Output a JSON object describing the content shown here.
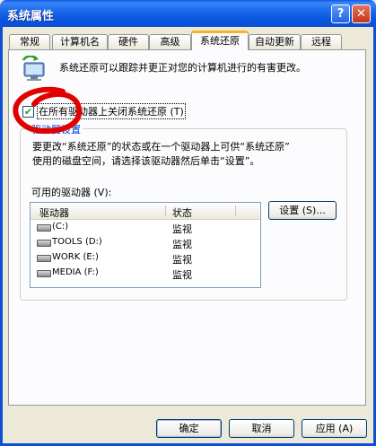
{
  "window": {
    "title": "系统属性",
    "help_glyph": "?",
    "close_glyph": "✕"
  },
  "tabs": [
    {
      "label": "常规"
    },
    {
      "label": "计算机名"
    },
    {
      "label": "硬件"
    },
    {
      "label": "高级"
    },
    {
      "label": "系统还原",
      "active": true
    },
    {
      "label": "自动更新"
    },
    {
      "label": "远程"
    }
  ],
  "info": {
    "text": "系统还原可以跟踪并更正对您的计算机进行的有害更改。"
  },
  "disable_all": {
    "label": "在所有驱动器上关闭系统还原 (T)",
    "checked": true,
    "check_glyph": "✔"
  },
  "drive_settings": {
    "group_label": "驱动器设置",
    "description_line1": "要更改“系统还原”的状态或在一个驱动器上可供“系统还原”",
    "description_line2": "使用的磁盘空间，请选择该驱动器然后单击“设置”。",
    "available_label": "可用的驱动器 (V):",
    "columns": {
      "drive": "驱动器",
      "status": "状态"
    },
    "drives": [
      {
        "name": "(C:)",
        "status": "监视"
      },
      {
        "name": "TOOLS (D:)",
        "status": "监视"
      },
      {
        "name": "WORK (E:)",
        "status": "监视"
      },
      {
        "name": "MEDIA (F:)",
        "status": "监视"
      }
    ],
    "settings_button": "设置 (S)..."
  },
  "buttons": {
    "ok": "确定",
    "cancel": "取消",
    "apply": "应用 (A)"
  },
  "colors": {
    "titlebar": "#0a55e0",
    "tab_highlight": "#f7b42a",
    "annotation": "#e00000",
    "group_label": "#0046d5"
  }
}
